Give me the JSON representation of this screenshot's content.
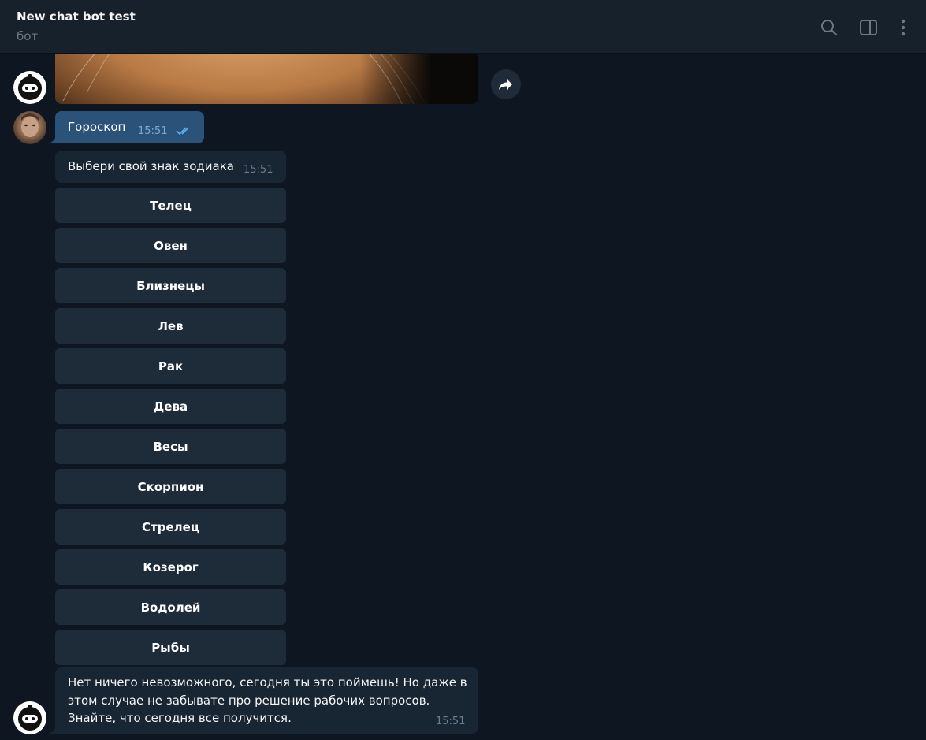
{
  "header": {
    "title": "New chat bot test",
    "status": "бот"
  },
  "icons": {
    "search": "search-icon",
    "sidebar": "sidebar-toggle-icon",
    "menu": "more-vertical-icon",
    "forward": "forward-arrow-icon"
  },
  "colors": {
    "background": "#0e1621",
    "header": "#17212b",
    "outgoing_bubble": "#2b5278",
    "incoming_bubble": "#182533",
    "keyboard_button": "#1e2c3a"
  },
  "messages": {
    "outgoing": {
      "text": "Гороскоп",
      "time": "15:51",
      "status": "read"
    },
    "prompt": {
      "text": "Выбери свой знак зодиака",
      "time": "15:51"
    },
    "keyboard": [
      "Телец",
      "Овен",
      "Близнецы",
      "Лев",
      "Рак",
      "Дева",
      "Весы",
      "Скорпион",
      "Стрелец",
      "Козерог",
      "Водолей",
      "Рыбы"
    ],
    "reply": {
      "line1": "Нет ничего невозможного, сегодня ты это поймешь! Но даже в",
      "line2": "этом случае не забывате про решение рабочих вопросов.",
      "line3": "Знайте, что сегодня все получится.",
      "time": "15:51"
    }
  }
}
